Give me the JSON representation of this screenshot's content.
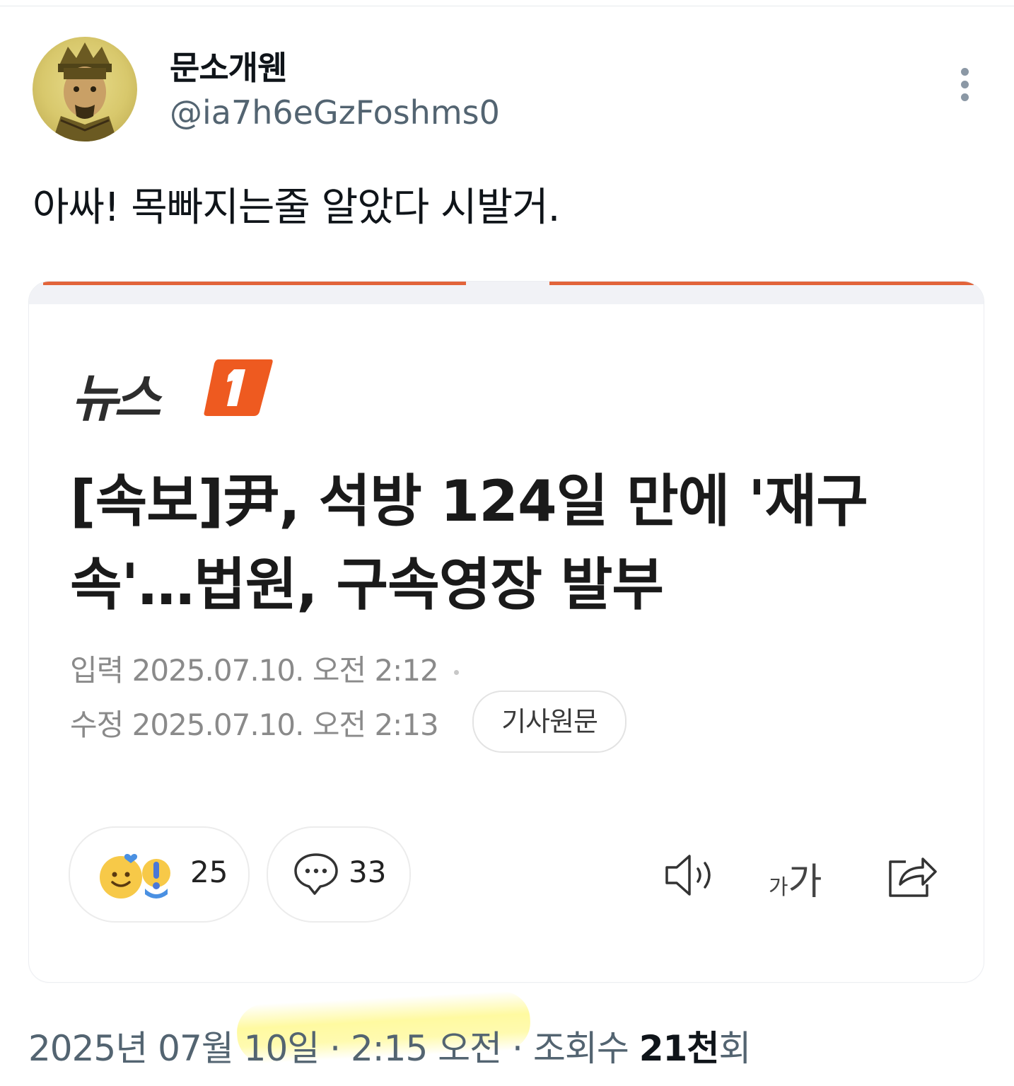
{
  "tweet": {
    "display_name": "문소개웬",
    "handle": "@ia7h6eGzFoshms0",
    "text": "아싸! 목빠지는줄 알았다 시발거.",
    "date": "2025년 07월 10일",
    "separator1": " · ",
    "time": "2:15 오전",
    "separator2": " · ",
    "views_label": "조회수 ",
    "views_count": "21천",
    "views_suffix": "회"
  },
  "card": {
    "source": "뉴스",
    "headline": "[속보]尹, 석방 124일 만에 '재구속'…법원, 구속영장 발부",
    "input_label": "입력",
    "input_datetime": "2025.07.10. 오전 2:12",
    "modified_label": "수정",
    "modified_datetime": "2025.07.10. 오전 2:13",
    "original_article_label": "기사원문",
    "reaction_count": "25",
    "comment_count": "33",
    "font_size_small": "가",
    "font_size_big": "가"
  },
  "icons": {
    "more": "more-vertical-icon",
    "reaction": "smile-emoji-icon",
    "comment": "speech-bubble-icon",
    "speaker": "speaker-icon",
    "share": "share-icon"
  },
  "colors": {
    "accent_orange": "#e2643a",
    "secondary_text": "#536471",
    "highlight_yellow": "#fff76e"
  }
}
